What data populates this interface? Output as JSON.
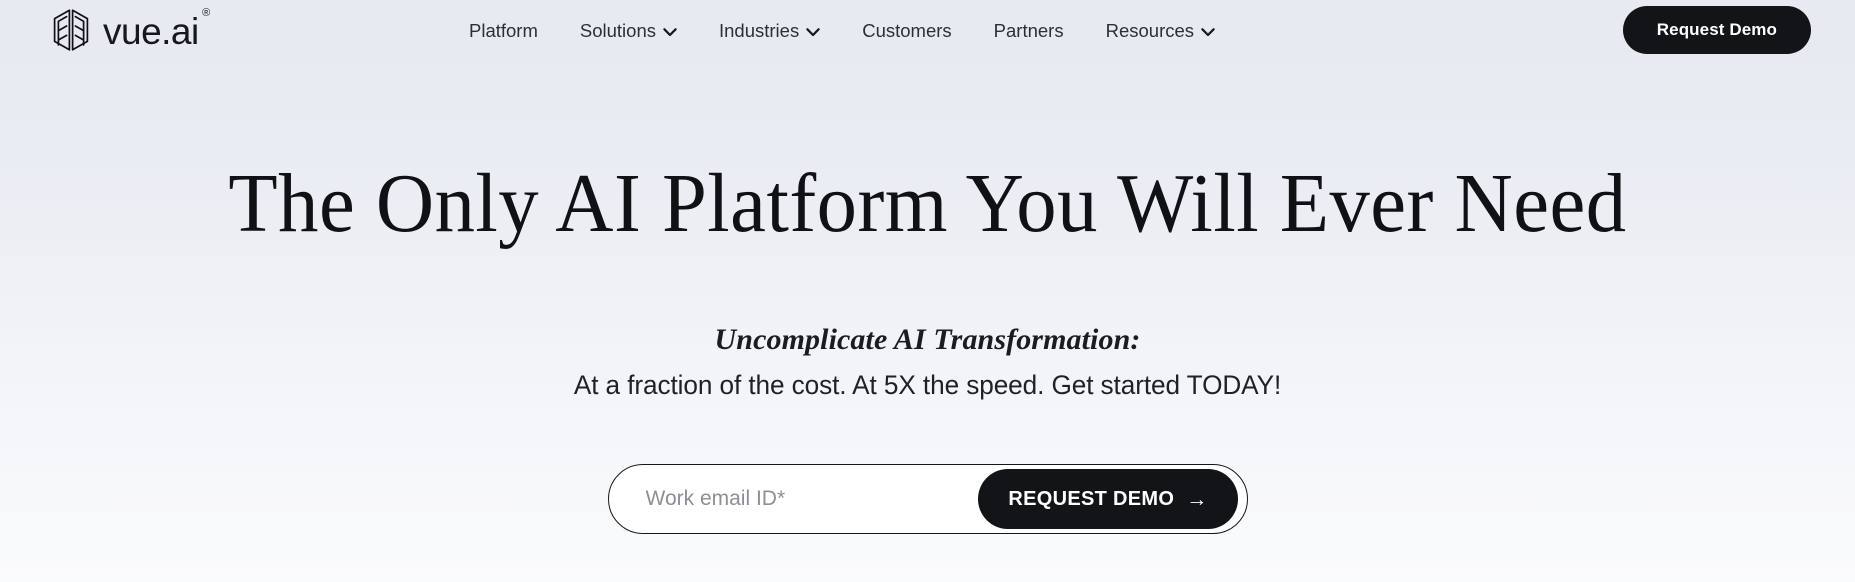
{
  "brand": {
    "wordmark": "vue.ai",
    "registered_symbol": "®",
    "logo_icon": "vue-hexagon-logo-icon"
  },
  "nav": {
    "items": [
      {
        "label": "Platform",
        "has_dropdown": false,
        "icon": ""
      },
      {
        "label": "Solutions",
        "has_dropdown": true,
        "icon": "chevron-down-icon"
      },
      {
        "label": "Industries",
        "has_dropdown": true,
        "icon": "chevron-down-icon"
      },
      {
        "label": "Customers",
        "has_dropdown": false,
        "icon": ""
      },
      {
        "label": "Partners",
        "has_dropdown": false,
        "icon": ""
      },
      {
        "label": "Resources",
        "has_dropdown": true,
        "icon": "chevron-down-icon"
      }
    ]
  },
  "header_cta": {
    "label": "Request Demo"
  },
  "hero": {
    "title": "The Only AI Platform You Will Ever Need",
    "subtitle": "Uncomplicate AI Transformation:",
    "tagline": "At a fraction of the cost. At 5X the speed. Get started TODAY!"
  },
  "form": {
    "email_placeholder": "Work email ID*",
    "email_value": "",
    "submit_label": "REQUEST DEMO",
    "submit_arrow": "→",
    "submit_arrow_icon": "arrow-right-icon"
  },
  "colors": {
    "background_top": "#e7eaf1",
    "background_bottom": "#fafbfc",
    "ink": "#131417",
    "nav_text": "#2c2f36",
    "placeholder": "#8d8f96",
    "button_bg": "#131417",
    "button_text": "#ffffff"
  }
}
